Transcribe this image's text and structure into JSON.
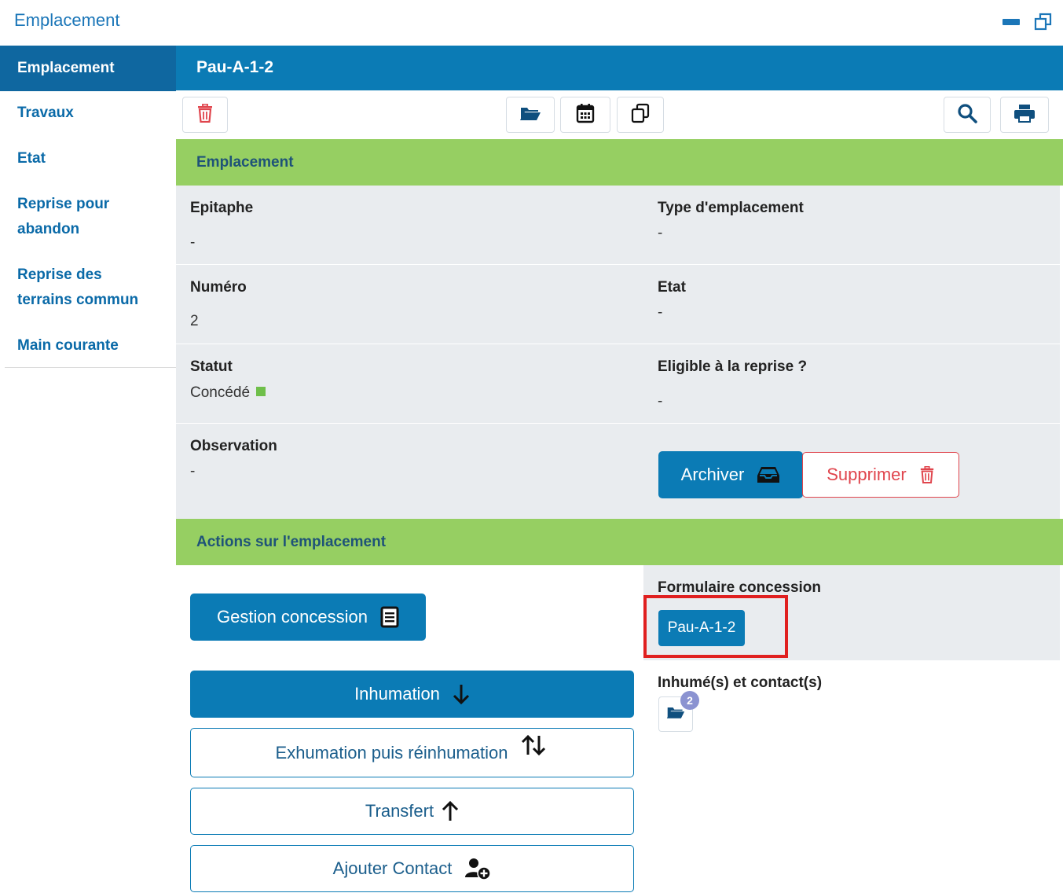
{
  "window": {
    "title": "Emplacement"
  },
  "sidebar": {
    "items": [
      {
        "label": "Emplacement"
      },
      {
        "label": "Travaux"
      },
      {
        "label": "Etat"
      },
      {
        "label": "Reprise pour abandon"
      },
      {
        "label": "Reprise des terrains commun"
      },
      {
        "label": "Main courante"
      }
    ]
  },
  "header": {
    "title": "Pau-A-1-2"
  },
  "toolbar": {
    "icons": [
      "trash-icon",
      "folder-open-icon",
      "calendar-icon",
      "copy-icon",
      "search-icon",
      "print-icon"
    ]
  },
  "section_emplacement": {
    "title": "Emplacement",
    "epitaphe_label": "Epitaphe",
    "epitaphe_value": "-",
    "type_label": "Type d'emplacement",
    "type_value": "-",
    "numero_label": "Numéro",
    "numero_value": "2",
    "etat_label": "Etat",
    "etat_value": "-",
    "statut_label": "Statut",
    "statut_value": "Concédé",
    "eligible_label": "Eligible à la reprise ?",
    "eligible_value": "-",
    "observation_label": "Observation",
    "observation_value": "-",
    "archiver_label": "Archiver",
    "supprimer_label": "Supprimer"
  },
  "section_actions": {
    "title": "Actions sur l'emplacement",
    "gestion_label": "Gestion concession",
    "formulaire_label": "Formulaire concession",
    "formulaire_button": "Pau-A-1-2",
    "inhumes_label": "Inhumé(s) et contact(s)",
    "inhumes_count": "2",
    "inhumation_label": "Inhumation",
    "exhumation_label": "Exhumation puis réinhumation",
    "transfert_label": "Transfert",
    "ajouter_contact_label": "Ajouter Contact"
  },
  "colors": {
    "primary": "#0b7bb5",
    "sidebar_active": "#0f67a0",
    "section_green": "#96cf62",
    "danger": "#e0454d",
    "highlight_box": "#e02020",
    "status_green": "#6fbf4a"
  }
}
